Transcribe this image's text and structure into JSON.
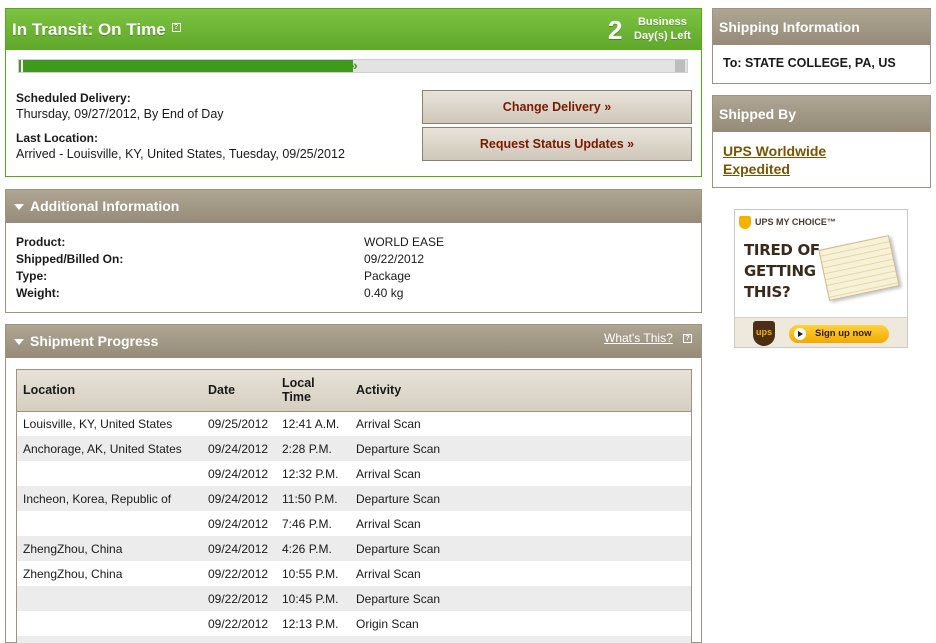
{
  "status": {
    "title": "In Transit: On Time",
    "help_glyph": "?",
    "days_count": "2",
    "days_label_line1": "Business",
    "days_label_line2": "Day(s) Left",
    "progress_fraction": 0.5
  },
  "delivery": {
    "scheduled_label": "Scheduled Delivery:",
    "scheduled_value": "Thursday, 09/27/2012, By End of Day",
    "last_location_label": "Last Location:",
    "last_location_value": "Arrived - Louisville, KY, United States, Tuesday, 09/25/2012"
  },
  "actions": {
    "change_delivery": "Change Delivery »",
    "request_updates": "Request Status Updates »"
  },
  "additional_info": {
    "header": "Additional Information",
    "rows": [
      {
        "label": "Product:",
        "value": "WORLD EASE"
      },
      {
        "label": "Shipped/Billed On:",
        "value": "09/22/2012"
      },
      {
        "label": "Type:",
        "value": "Package"
      },
      {
        "label": "Weight:",
        "value": "0.40 kg"
      }
    ]
  },
  "shipment_progress": {
    "header": "Shipment Progress",
    "whats_this": "What's This?",
    "columns": [
      "Location",
      "Date",
      "Local Time",
      "Activity"
    ],
    "rows": [
      {
        "location": "Louisville, KY, United States",
        "date": "09/25/2012",
        "time": "12:41 A.M.",
        "activity": "Arrival Scan"
      },
      {
        "location": "Anchorage, AK, United States",
        "date": "09/24/2012",
        "time": "2:28 P.M.",
        "activity": "Departure Scan"
      },
      {
        "location": "",
        "date": "09/24/2012",
        "time": "12:32 P.M.",
        "activity": "Arrival Scan"
      },
      {
        "location": "Incheon, Korea, Republic of",
        "date": "09/24/2012",
        "time": "11:50 P.M.",
        "activity": "Departure Scan"
      },
      {
        "location": "",
        "date": "09/24/2012",
        "time": "7:46 P.M.",
        "activity": "Arrival Scan"
      },
      {
        "location": "ZhengZhou, China",
        "date": "09/24/2012",
        "time": "4:26 P.M.",
        "activity": "Departure Scan"
      },
      {
        "location": "ZhengZhou, China",
        "date": "09/22/2012",
        "time": "10:55 P.M.",
        "activity": "Arrival Scan"
      },
      {
        "location": "",
        "date": "09/22/2012",
        "time": "10:45 P.M.",
        "activity": "Departure Scan"
      },
      {
        "location": "",
        "date": "09/22/2012",
        "time": "12:13 P.M.",
        "activity": "Origin Scan"
      },
      {
        "location": "",
        "date": "",
        "time": "",
        "activity": ""
      }
    ]
  },
  "shipping_info": {
    "header": "Shipping Information",
    "to": "To:  STATE COLLEGE, PA, US"
  },
  "shipped_by": {
    "header": "Shipped By",
    "service_line1": "UPS Worldwide",
    "service_line2": "Expedited"
  },
  "ad": {
    "brand": "UPS MY CHOICE™",
    "headline_line1": "TIRED OF",
    "headline_line2": "GETTING",
    "headline_line3": "THIS?",
    "logo_text": "ups",
    "signup": "Sign up now"
  },
  "colors": {
    "status_green": "#5fa82a",
    "section_taupe": "#958b78",
    "button_text": "#7a1a00",
    "link_brown": "#7a5400"
  }
}
